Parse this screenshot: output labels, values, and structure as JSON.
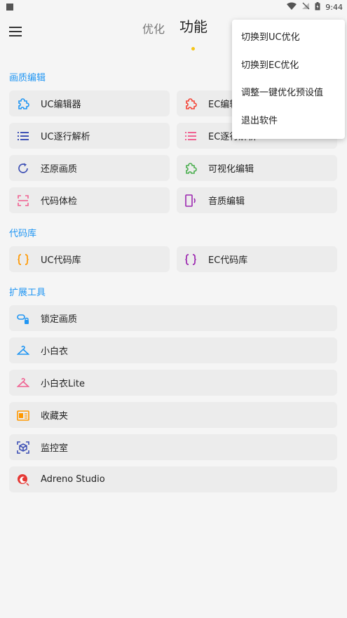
{
  "status": {
    "time": "9:44"
  },
  "tabs": [
    {
      "label": "优化"
    },
    {
      "label": "功能"
    }
  ],
  "sections": [
    {
      "title": "画质编辑",
      "items": [
        {
          "label": "UC编辑器",
          "icon": "puzzle-icon",
          "color": "#2196f3"
        },
        {
          "label": "EC编辑器",
          "icon": "puzzle-icon",
          "color": "#f44336"
        },
        {
          "label": "UC逐行解析",
          "icon": "list-icon",
          "color": "#3f51b5"
        },
        {
          "label": "EC逐行解析",
          "icon": "list-icon",
          "color": "#f06292"
        },
        {
          "label": "还原画质",
          "icon": "restore-icon",
          "color": "#3f51b5"
        },
        {
          "label": "可视化编辑",
          "icon": "puzzle-icon",
          "color": "#4caf50"
        },
        {
          "label": "代码体检",
          "icon": "scan-icon",
          "color": "#f06292"
        },
        {
          "label": "音质编辑",
          "icon": "phone-sound-icon",
          "color": "#9c27b0"
        }
      ]
    },
    {
      "title": "代码库",
      "items": [
        {
          "label": "UC代码库",
          "icon": "braces-icon",
          "color": "#ff9800"
        },
        {
          "label": "EC代码库",
          "icon": "braces-icon",
          "color": "#9c27b0"
        }
      ]
    },
    {
      "title": "扩展工具",
      "items": [
        {
          "label": "锁定画质",
          "icon": "link-lock-icon",
          "color": "#2196f3"
        },
        {
          "label": "小白衣",
          "icon": "hanger-icon",
          "color": "#2196f3"
        },
        {
          "label": "小白衣Lite",
          "icon": "hanger-icon",
          "color": "#f06292"
        },
        {
          "label": "收藏夹",
          "icon": "folder-star-icon",
          "color": "#ff9800"
        },
        {
          "label": "监控室",
          "icon": "monitor-cube-icon",
          "color": "#3f51b5"
        },
        {
          "label": "Adreno Studio",
          "icon": "adreno-icon",
          "color": "#e53935"
        }
      ]
    }
  ],
  "popup_menu": [
    {
      "label": "切换到UC优化"
    },
    {
      "label": "切换到EC优化"
    },
    {
      "label": "调整一键优化预设值"
    },
    {
      "label": "退出软件"
    }
  ]
}
